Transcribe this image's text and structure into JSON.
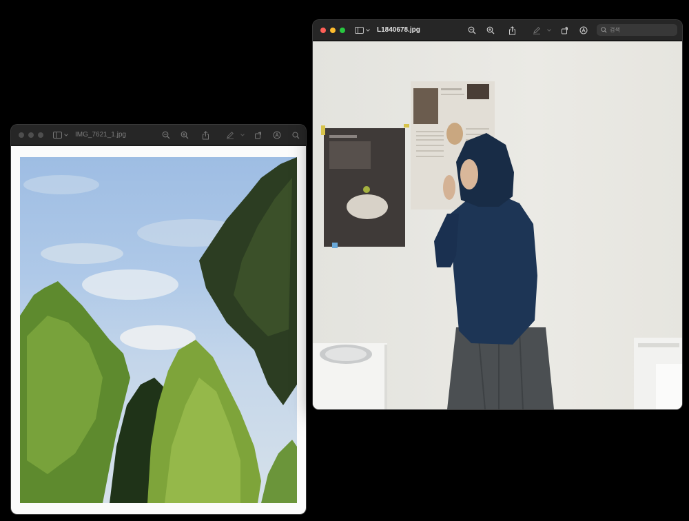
{
  "windows": {
    "left": {
      "title": "IMG_7621_1.jpg",
      "active": false
    },
    "right": {
      "title": "L1840678.jpg",
      "active": true,
      "search": {
        "placeholder": "검색",
        "value": ""
      }
    }
  },
  "icons": {
    "sidebar": "sidebar-icon",
    "zoom_out": "zoom-out-icon",
    "zoom_in": "zoom-in-icon",
    "share": "share-icon",
    "markup": "markup-pen-icon",
    "rotate": "rotate-icon",
    "annotate": "annotate-icon",
    "search": "search-icon"
  },
  "colors": {
    "close": "#ff5f57",
    "minimize": "#febc2e",
    "zoom": "#28c840",
    "titlebar": "#262626",
    "desktop": "#000000"
  }
}
